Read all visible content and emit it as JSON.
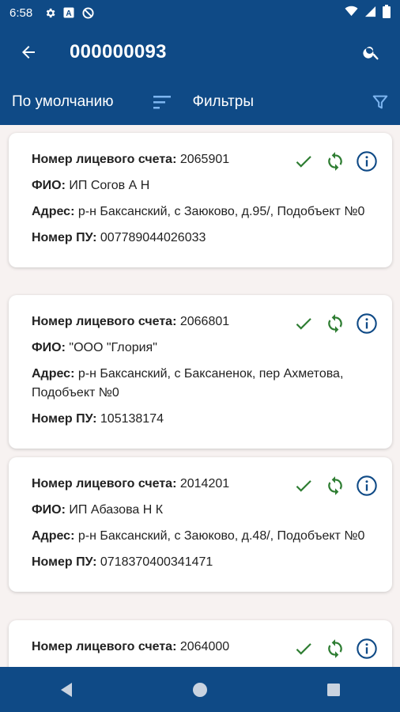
{
  "status_bar": {
    "time": "6:58",
    "icons": [
      "gear-icon",
      "a-box-icon",
      "no-disturb-icon"
    ],
    "right_icons": [
      "wifi-icon",
      "signal-icon",
      "battery-icon"
    ]
  },
  "header": {
    "title": "000000093",
    "back_icon": "arrow-left-icon",
    "search_icon": "search-icon"
  },
  "filter_bar": {
    "sort_label": "По умолчанию",
    "filters_label": "Фильтры"
  },
  "labels": {
    "account": "Номер лицевого счета:",
    "fio": "ФИО:",
    "address": "Адрес:",
    "meter": "Номер ПУ:"
  },
  "cards": [
    {
      "account": "2065901",
      "fio": "ИП Согов А Н",
      "address": "р-н Баксанский, с Заюково, д.95/, Подобъект №0",
      "meter": "007789044026033"
    },
    {
      "account": "2066801",
      "fio": "\"ООО \"Глория\"",
      "address": "р-н Баксанский, с Баксаненок, пер Ахметова, Подобъект №0",
      "meter": "105138174"
    },
    {
      "account": "2014201",
      "fio": "ИП Абазова Н К",
      "address": "р-н Баксанский, с Заюково, д.48/, Подобъект №0",
      "meter": "0718370400341471"
    },
    {
      "account": "2064000",
      "fio": "",
      "address": "",
      "meter": ""
    }
  ],
  "colors": {
    "primary": "#0f4a86",
    "check": "#2e7d32",
    "info": "#0f4a86",
    "background": "#f7f2f1"
  }
}
